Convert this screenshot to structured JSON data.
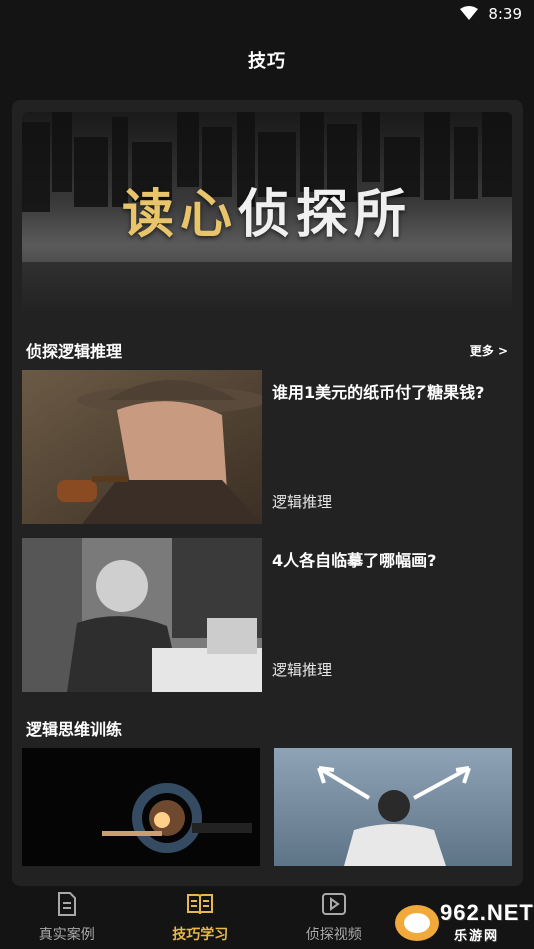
{
  "status_bar": {
    "time": "8:39"
  },
  "header": {
    "title": "技巧"
  },
  "banner": {
    "title_part1": "读心",
    "title_part2": "侦探所"
  },
  "section_logic": {
    "title": "侦探逻辑推理",
    "more": "更多 >",
    "articles": [
      {
        "title": "谁用1美元的纸币付了糖果钱?",
        "tag": "逻辑推理"
      },
      {
        "title": "4人各自临摹了哪幅画?",
        "tag": "逻辑推理"
      }
    ]
  },
  "section_training": {
    "title": "逻辑思维训练"
  },
  "bottom_nav": {
    "items": [
      {
        "label": "真实案例",
        "icon": "document-icon"
      },
      {
        "label": "技巧学习",
        "icon": "book-icon"
      },
      {
        "label": "侦探视频",
        "icon": "video-icon"
      }
    ],
    "active_index": 1
  },
  "watermark": {
    "logo_text": "962.NET",
    "sub_text": "乐游网"
  },
  "colors": {
    "background": "#141414",
    "card": "#222222",
    "accent": "#e8b84a",
    "banner_gold": "#e8c56a"
  }
}
